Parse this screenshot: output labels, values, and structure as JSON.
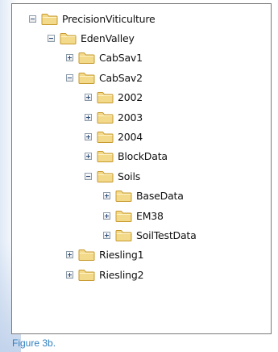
{
  "tree": {
    "nodes": [
      {
        "label": "PrecisionViticulture",
        "expanded": true,
        "depth": 0
      },
      {
        "label": "EdenValley",
        "expanded": true,
        "depth": 1
      },
      {
        "label": "CabSav1",
        "expanded": false,
        "depth": 2
      },
      {
        "label": "CabSav2",
        "expanded": true,
        "depth": 2
      },
      {
        "label": "2002",
        "expanded": false,
        "depth": 3
      },
      {
        "label": "2003",
        "expanded": false,
        "depth": 3
      },
      {
        "label": "2004",
        "expanded": false,
        "depth": 3
      },
      {
        "label": "BlockData",
        "expanded": false,
        "depth": 3
      },
      {
        "label": "Soils",
        "expanded": true,
        "depth": 3
      },
      {
        "label": "BaseData",
        "expanded": false,
        "depth": 4
      },
      {
        "label": "EM38",
        "expanded": false,
        "depth": 4
      },
      {
        "label": "SoilTestData",
        "expanded": false,
        "depth": 4
      },
      {
        "label": "Riesling1",
        "expanded": false,
        "depth": 2
      },
      {
        "label": "Riesling2",
        "expanded": false,
        "depth": 2
      }
    ]
  },
  "caption": {
    "text": "Figure 3b."
  },
  "colors": {
    "folder_fill": "#f3d98a",
    "folder_edge": "#c79a2e",
    "caption": "#2f7fbf",
    "toggle_sign": "#2f4f7f"
  },
  "icons": {
    "folder": "folder-icon",
    "expand": "plus-icon",
    "collapse": "minus-icon"
  }
}
